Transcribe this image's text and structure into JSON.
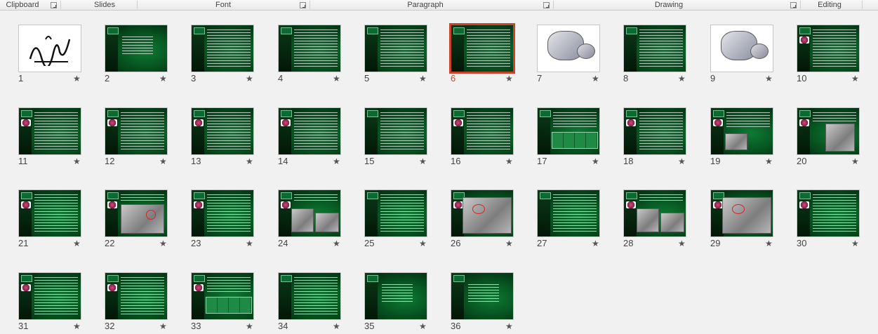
{
  "ribbon": {
    "groups": [
      {
        "label": "Clipboard",
        "has_launcher": true
      },
      {
        "label": "Slides",
        "has_launcher": false
      },
      {
        "label": "Font",
        "has_launcher": true
      },
      {
        "label": "Paragraph",
        "has_launcher": true
      },
      {
        "label": "Drawing",
        "has_launcher": true
      },
      {
        "label": "Editing",
        "has_launcher": false
      }
    ]
  },
  "sorter": {
    "selected_slide": 6,
    "star_icon": "animation-star-icon",
    "slides": [
      {
        "number": "1",
        "star": "★",
        "kind": "calligraphy"
      },
      {
        "number": "2",
        "star": "★",
        "kind": "title"
      },
      {
        "number": "3",
        "star": "★",
        "kind": "text"
      },
      {
        "number": "4",
        "star": "★",
        "kind": "text"
      },
      {
        "number": "5",
        "star": "★",
        "kind": "text"
      },
      {
        "number": "6",
        "star": "★",
        "kind": "text"
      },
      {
        "number": "7",
        "star": "★",
        "kind": "diagram"
      },
      {
        "number": "8",
        "star": "★",
        "kind": "text"
      },
      {
        "number": "9",
        "star": "★",
        "kind": "diagram"
      },
      {
        "number": "10",
        "star": "★",
        "kind": "text-flower"
      },
      {
        "number": "11",
        "star": "★",
        "kind": "text-flower"
      },
      {
        "number": "12",
        "star": "★",
        "kind": "text-flower"
      },
      {
        "number": "13",
        "star": "★",
        "kind": "text-flower"
      },
      {
        "number": "14",
        "star": "★",
        "kind": "text-flower"
      },
      {
        "number": "15",
        "star": "★",
        "kind": "text"
      },
      {
        "number": "16",
        "star": "★",
        "kind": "text-flower"
      },
      {
        "number": "17",
        "star": "★",
        "kind": "table"
      },
      {
        "number": "18",
        "star": "★",
        "kind": "text-flower"
      },
      {
        "number": "19",
        "star": "★",
        "kind": "photo-small"
      },
      {
        "number": "20",
        "star": "★",
        "kind": "photo-part"
      },
      {
        "number": "21",
        "star": "★",
        "kind": "text-flower"
      },
      {
        "number": "22",
        "star": "★",
        "kind": "photo-marked"
      },
      {
        "number": "23",
        "star": "★",
        "kind": "text-flower"
      },
      {
        "number": "24",
        "star": "★",
        "kind": "photo-pair"
      },
      {
        "number": "25",
        "star": "★",
        "kind": "text"
      },
      {
        "number": "26",
        "star": "★",
        "kind": "photo-large"
      },
      {
        "number": "27",
        "star": "★",
        "kind": "text"
      },
      {
        "number": "28",
        "star": "★",
        "kind": "photo-pair"
      },
      {
        "number": "29",
        "star": "★",
        "kind": "photo-large"
      },
      {
        "number": "30",
        "star": "★",
        "kind": "text-flower"
      },
      {
        "number": "31",
        "star": "★",
        "kind": "text-flower"
      },
      {
        "number": "32",
        "star": "★",
        "kind": "text-flower"
      },
      {
        "number": "33",
        "star": "★",
        "kind": "table-flower"
      },
      {
        "number": "34",
        "star": "★",
        "kind": "text"
      },
      {
        "number": "35",
        "star": "★",
        "kind": "title"
      },
      {
        "number": "36",
        "star": "★",
        "kind": "title"
      }
    ]
  }
}
